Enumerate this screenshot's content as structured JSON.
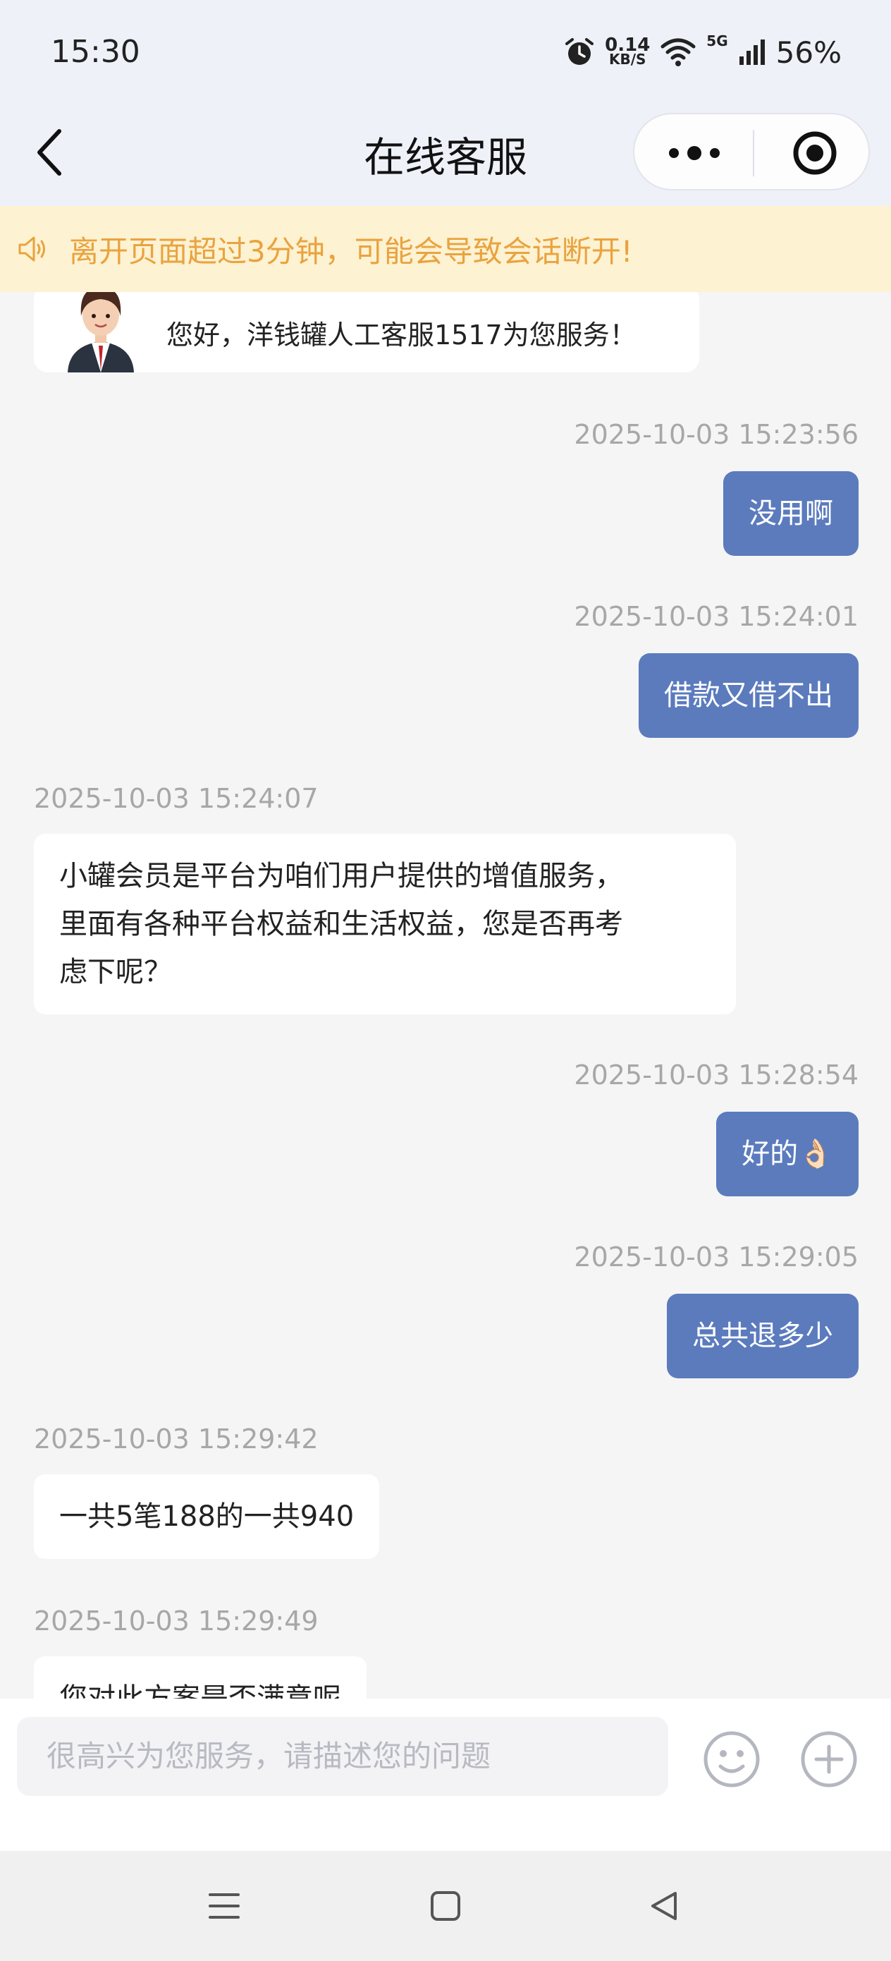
{
  "status_bar": {
    "time": "15:30",
    "net_speed_value": "0.14",
    "net_speed_unit": "KB/S",
    "network": "5G",
    "battery": "56%"
  },
  "header": {
    "title": "在线客服"
  },
  "notice": {
    "text": "离开页面超过3分钟，可能会导致会话断开!"
  },
  "chat": {
    "agent_intro": "您好，洋钱罐人工客服1517为您服务！",
    "messages": [
      {
        "side": "me",
        "time": "2025-10-03 15:23:56",
        "text": "没用啊"
      },
      {
        "side": "me",
        "time": "2025-10-03 15:24:01",
        "text": "借款又借不出"
      },
      {
        "side": "agent",
        "time": "2025-10-03 15:24:07",
        "lines": [
          "小罐会员是平台为咱们用户提供的增值服务，",
          "里面有各种平台权益和生活权益，您是否再考",
          "虑下呢？"
        ]
      },
      {
        "side": "me",
        "time": "2025-10-03 15:28:54",
        "text": "好的👌🏻"
      },
      {
        "side": "me",
        "time": "2025-10-03 15:29:05",
        "text": "总共退多少"
      },
      {
        "side": "agent",
        "time": "2025-10-03 15:29:42",
        "text": "一共5笔188的一共940"
      },
      {
        "side": "agent",
        "time": "2025-10-03 15:29:49",
        "text": "您对此方案是否满意呢"
      }
    ]
  },
  "input": {
    "placeholder": "很高兴为您服务，请描述您的问题"
  },
  "colors": {
    "my_bubble": "#5b7bbd",
    "notice_bg": "#fdf2d2",
    "notice_text": "#e9a33f"
  },
  "icons": [
    "back-arrow-icon",
    "more-dots-icon",
    "close-target-icon",
    "speaker-icon",
    "emoji-icon",
    "plus-icon",
    "menu-icon",
    "home-icon",
    "back-triangle-icon"
  ]
}
